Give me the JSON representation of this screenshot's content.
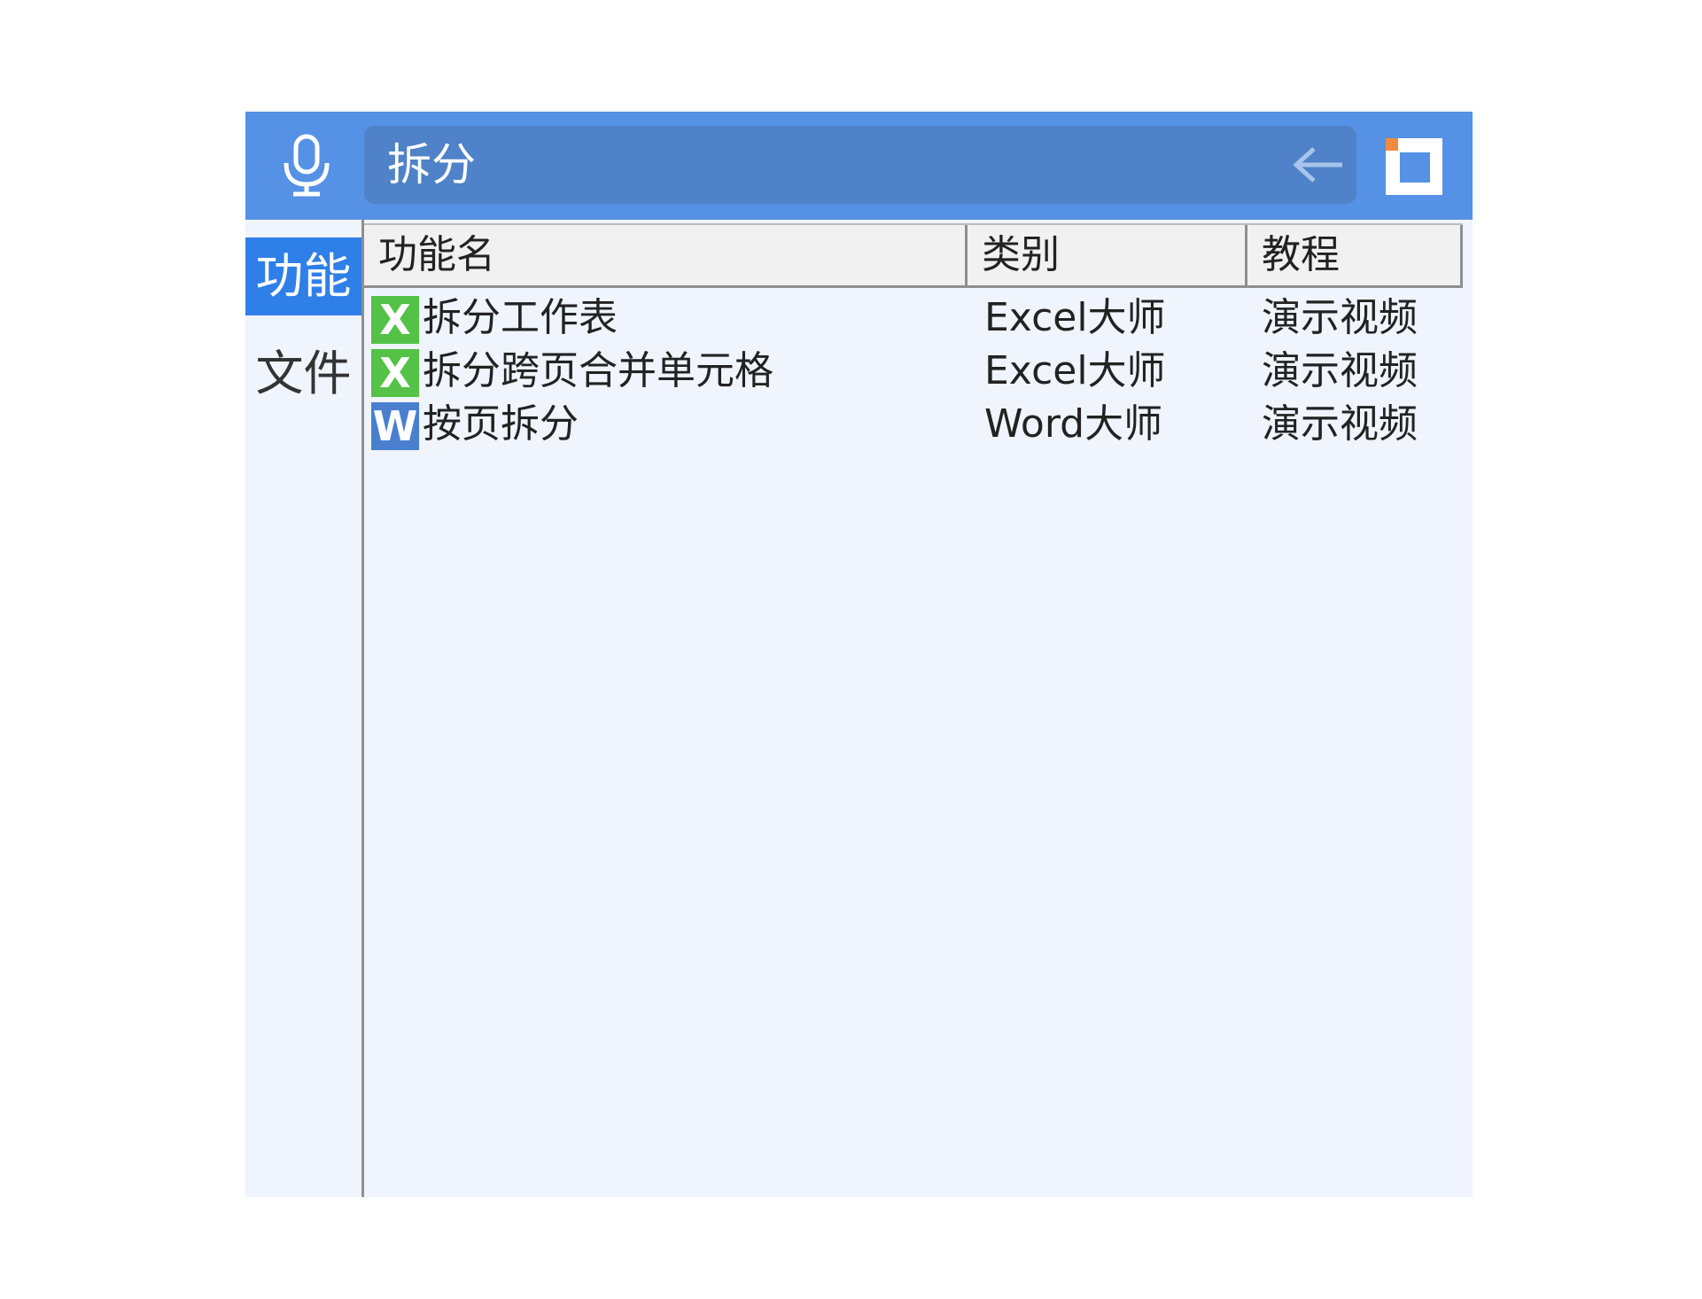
{
  "search": {
    "query": "拆分"
  },
  "sidebar": {
    "tabs": [
      {
        "label": "功能",
        "active": true
      },
      {
        "label": "文件",
        "active": false
      }
    ]
  },
  "table": {
    "headers": [
      "功能名",
      "类别",
      "教程"
    ],
    "rows": [
      {
        "icon": "X",
        "icon_color": "#54c147",
        "name": "拆分工作表",
        "category": "Excel大师",
        "tutorial": "演示视频"
      },
      {
        "icon": "X",
        "icon_color": "#54c147",
        "name": "拆分跨页合并单元格",
        "category": "Excel大师",
        "tutorial": "演示视频"
      },
      {
        "icon": "W",
        "icon_color": "#4a7fd0",
        "name": "按页拆分",
        "category": "Word大师",
        "tutorial": "演示视频"
      }
    ]
  },
  "colors": {
    "topbar": "#5591e4",
    "search_box": "#4f82c8",
    "active_tab": "#2f7fe9",
    "panel_bg": "#eff4fd",
    "logo_accent": "#f08a3c"
  }
}
